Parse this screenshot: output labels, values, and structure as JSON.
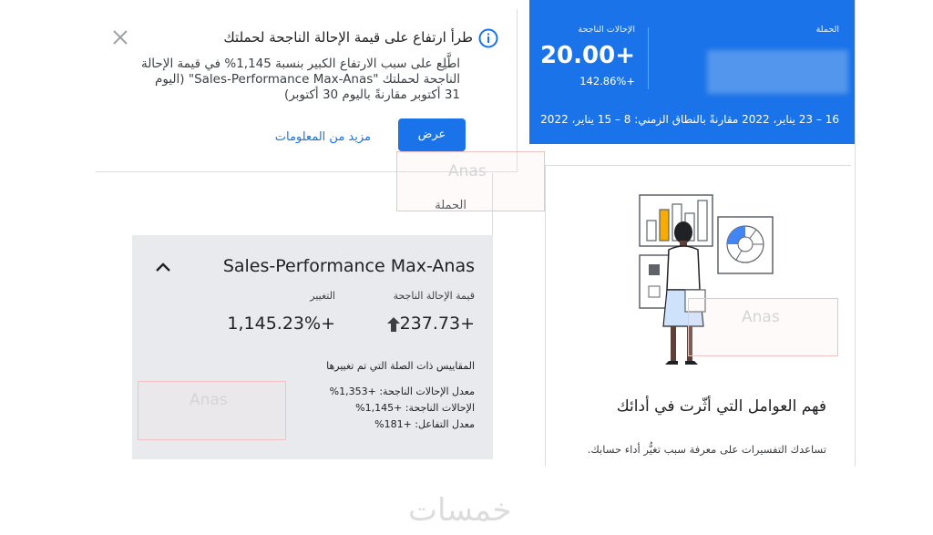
{
  "notification": {
    "title": "طرأ ارتفاع على قيمة الإحالة الناجحة لحملتك",
    "body": "اطَّلِع على سبب الارتفاع الكبير بنسبة 1,145% في قيمة الإحالة الناجحة لحملتك \"Sales-Performance Max-Anas\" (اليوم 31 أكتوبر مقارنةً باليوم 30 أكتوبر)",
    "view_button": "عرض",
    "more_info_link": "مزيد من المعلومات",
    "close_icon": "close-icon",
    "info_icon": "info-icon"
  },
  "campaign_section": {
    "label": "الحملة"
  },
  "campaign_detail": {
    "name": "Sales-Performance Max-Anas",
    "metrics": [
      {
        "label": "قيمة الإحالة الناجحة",
        "value": "237.73+"
      },
      {
        "label": "التغيير",
        "value": "1,145.23%+"
      }
    ],
    "related_heading": "المقاييس ذات الصلة التي تم تغييرها",
    "related_metrics": [
      "معدل الإحالات الناجحة: +1,353%",
      "الإحالات الناجحة: +1,145%",
      "معدل التفاعل: +181%"
    ]
  },
  "stats_card": {
    "campaign_col_label": "الحملة",
    "conversions_col_label": "الإحالات الناجحة",
    "conversions_value": "20.00+",
    "conversions_change": "142.86%+",
    "date_range": "16 – 23 يناير، 2022 مقارنةً بالنطاق الزمني: 8 – 15 يناير، 2022",
    "accent_color": "#1a73e8"
  },
  "insight_card": {
    "title": "فهم العوامل التي أثّرت في أدائك",
    "description": "تساعدك التفسيرات على معرفة سبب تغيُّر أداء حسابك."
  },
  "watermarks": [
    "Anas",
    "Anas",
    "Anas"
  ],
  "brand_wordmark": "خمسات"
}
